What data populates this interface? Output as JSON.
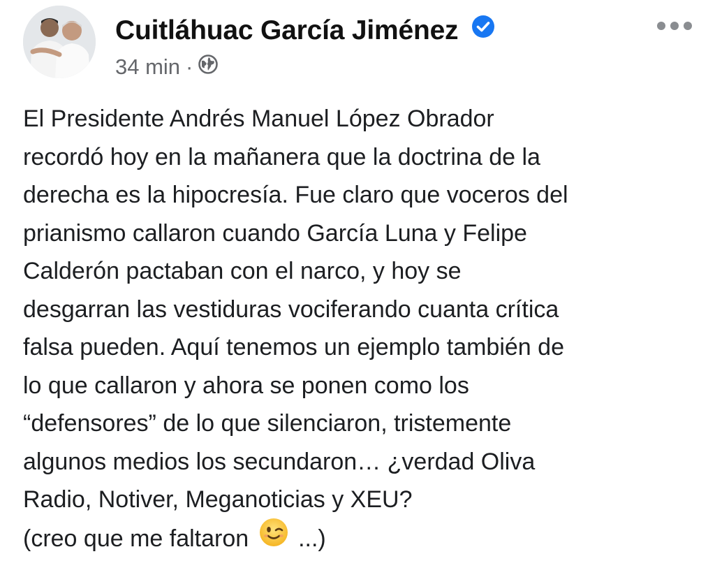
{
  "post": {
    "author": "Cuitláhuac García Jiménez",
    "timestamp": "34 min",
    "separator": "·",
    "privacy_icon": "globe-icon",
    "verified_icon": "verified-badge-icon",
    "more_icon": "more-options-icon",
    "lines": [
      "El Presidente Andrés Manuel López Obrador",
      "recordó hoy en la mañanera que la doctrina de la",
      "derecha es la hipocresía. Fue claro que voceros del",
      "prianismo callaron cuando García Luna y Felipe",
      "Calderón pactaban con el narco, y hoy se",
      "desgarran las vestiduras vociferando cuanta crítica",
      "falsa pueden. Aquí tenemos un ejemplo también de",
      "lo que callaron y ahora se ponen como los",
      "“defensores” de lo que silenciaron, tristemente",
      "algunos medios los secundaron… ¿verdad Oliva",
      "Radio, Notiver, Meganoticias y XEU?"
    ],
    "last_line_before": "(creo que me faltaron",
    "last_line_emoji": "winking-face-emoji",
    "last_line_after": "...)",
    "colors": {
      "verified_blue": "#1877f2",
      "meta_gray": "#65676b",
      "text": "#1c1e21"
    }
  }
}
